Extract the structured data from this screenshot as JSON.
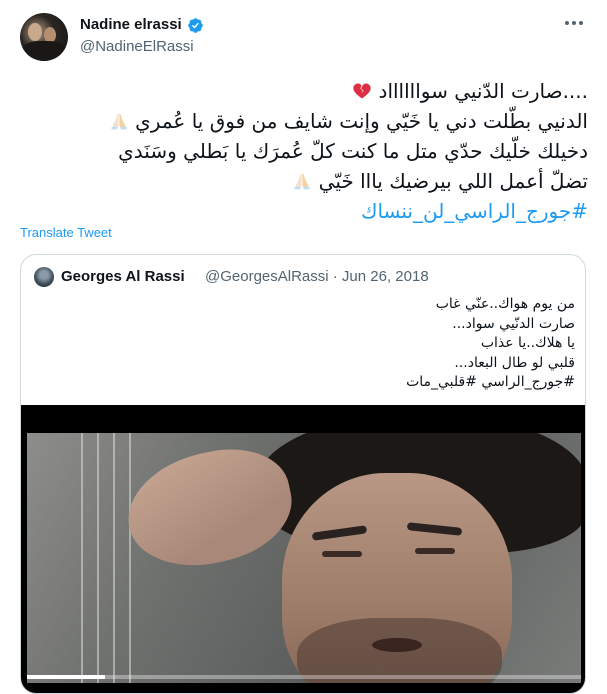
{
  "author": {
    "name": "Nadine elrassi",
    "handle": "@NadineElRassi",
    "verified": true
  },
  "tweet": {
    "lines": [
      "....صارت الدّنيي سوااااااد",
      "الدنيي بطّلت دني يا خَيّي وإنت شايف من فوق يا عُمري",
      "دخيلك خلّيك حدّي متل ما كنت كلّ عُمرَك يا بَطلي وسَنَدي",
      "تضلّ أعمل اللي بيرضيك يااا خَيّي"
    ],
    "hashtag": "#جورج_الراسي_لن_ننساك",
    "emoji": {
      "line1": "broken-heart-icon",
      "line2": "folded-hands-icon",
      "line4": "folded-hands-icon"
    }
  },
  "translate_label": "Translate Tweet",
  "quoted": {
    "name": "Georges Al Rassi",
    "handle_date": "@GeorgesAlRassi · Jun 26, 2018",
    "lines": [
      "من يوم هواك..عنّي غاب",
      "صارت الدنّيي سواد...",
      "يا هلاك..يا عذاب",
      "قلبي لو طال البعاد...",
      "#جورج_الراسي #قلبي_مات"
    ],
    "video": {
      "progress": 0.14
    }
  },
  "colors": {
    "accent": "#1d9bf0",
    "text": "#0f1419",
    "secondary": "#536471",
    "border": "#cfd9de"
  }
}
